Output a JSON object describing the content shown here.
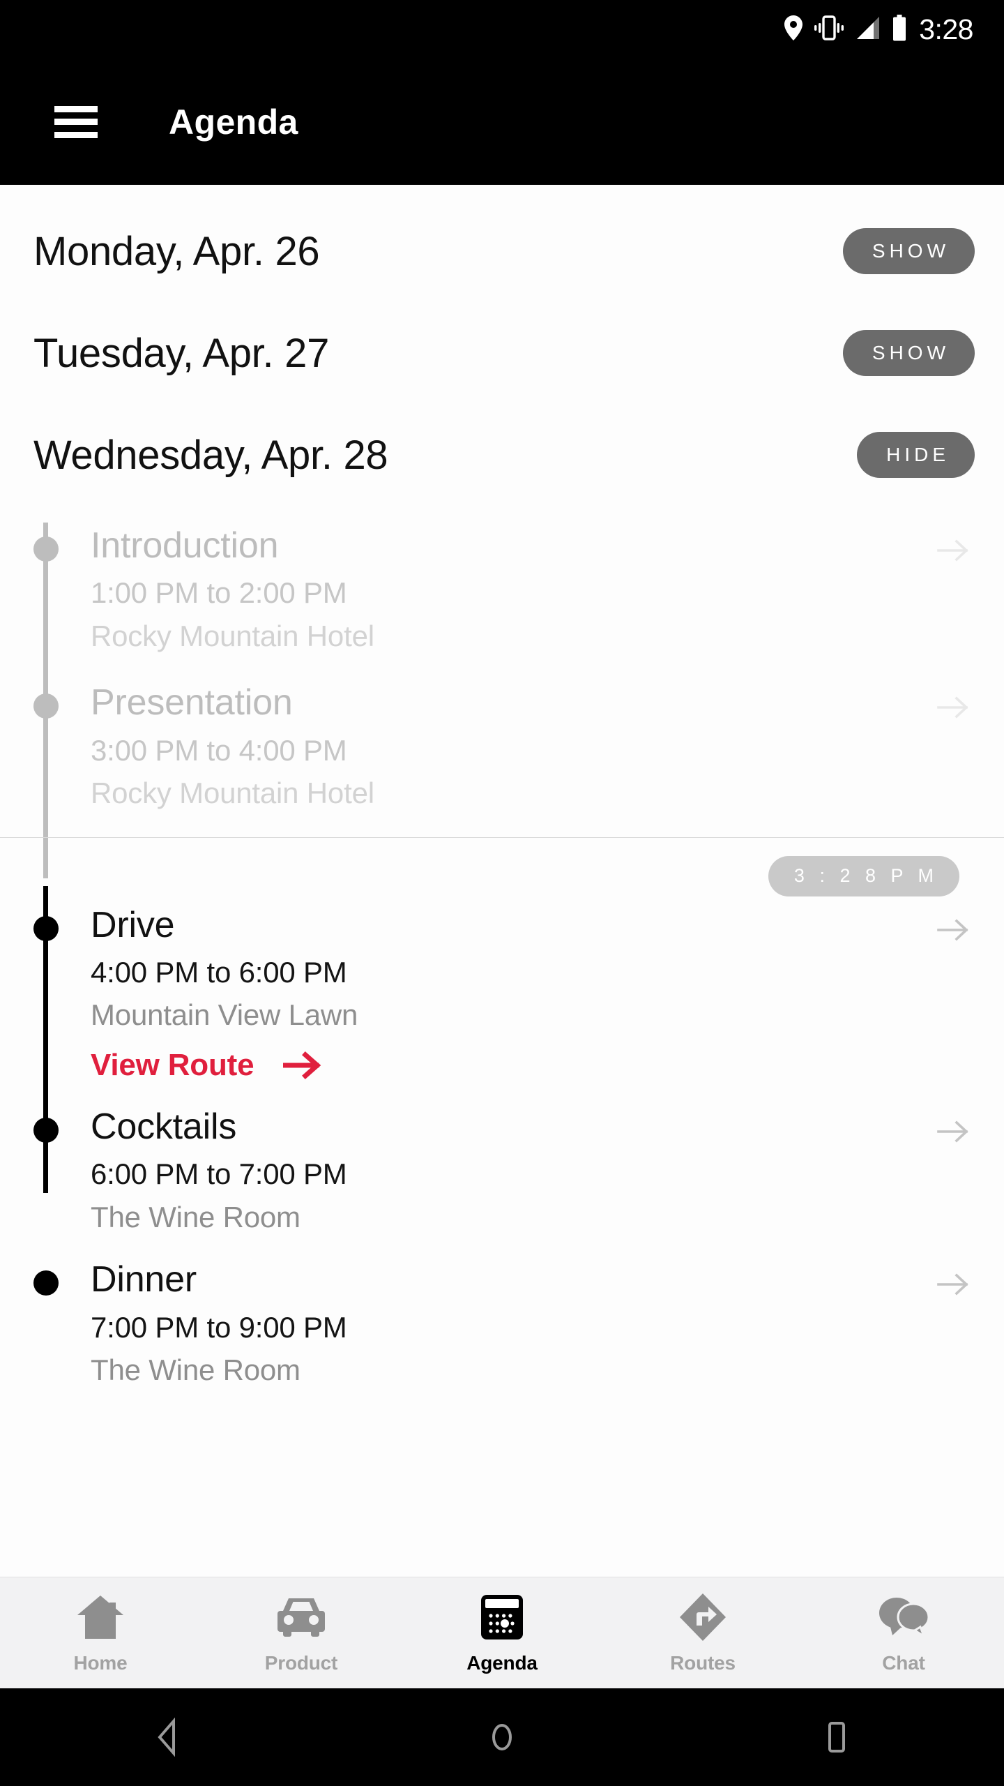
{
  "status_bar": {
    "time": "3:28",
    "icons": [
      "location-pin-icon",
      "vibrate-icon",
      "signal-icon",
      "battery-icon"
    ]
  },
  "app_bar": {
    "menu_icon": "hamburger-menu-icon",
    "title": "Agenda"
  },
  "days": [
    {
      "label": "Monday, Apr. 26",
      "toggle": "SHOW",
      "expanded": false
    },
    {
      "label": "Tuesday, Apr. 27",
      "toggle": "SHOW",
      "expanded": false
    },
    {
      "label": "Wednesday, Apr. 28",
      "toggle": "HIDE",
      "expanded": true
    }
  ],
  "now_badge": "3 : 2 8   P M",
  "events": [
    {
      "title": "Introduction",
      "time": "1:00 PM to 2:00 PM",
      "place": "Rocky Mountain Hotel",
      "state": "past"
    },
    {
      "title": "Presentation",
      "time": "3:00 PM to 4:00 PM",
      "place": "Rocky Mountain Hotel",
      "state": "past"
    },
    {
      "title": "Drive",
      "time": "4:00 PM to 6:00 PM",
      "place": "Mountain View Lawn",
      "state": "upcoming",
      "route_link": "View Route"
    },
    {
      "title": "Cocktails",
      "time": "6:00 PM to 7:00 PM",
      "place": "The Wine Room",
      "state": "upcoming"
    },
    {
      "title": "Dinner",
      "time": "7:00 PM to 9:00 PM",
      "place": "The Wine Room",
      "state": "upcoming"
    }
  ],
  "bottom_nav": [
    {
      "label": "Home",
      "icon": "house-icon",
      "active": false
    },
    {
      "label": "Product",
      "icon": "car-icon",
      "active": false
    },
    {
      "label": "Agenda",
      "icon": "calendar-icon",
      "active": true
    },
    {
      "label": "Routes",
      "icon": "navigation-icon",
      "active": false
    },
    {
      "label": "Chat",
      "icon": "chat-bubbles-icon",
      "active": false
    }
  ],
  "android_nav": [
    {
      "icon": "back-triangle-icon"
    },
    {
      "icon": "home-circle-icon"
    },
    {
      "icon": "recents-square-icon"
    }
  ],
  "colors": {
    "accent_red": "#e01f3d",
    "toggle_gray": "#6b6b6b",
    "badge_gray": "#c9c9c9",
    "past_text": "#bcbcbc",
    "nav_inactive": "#a2a2a2"
  }
}
